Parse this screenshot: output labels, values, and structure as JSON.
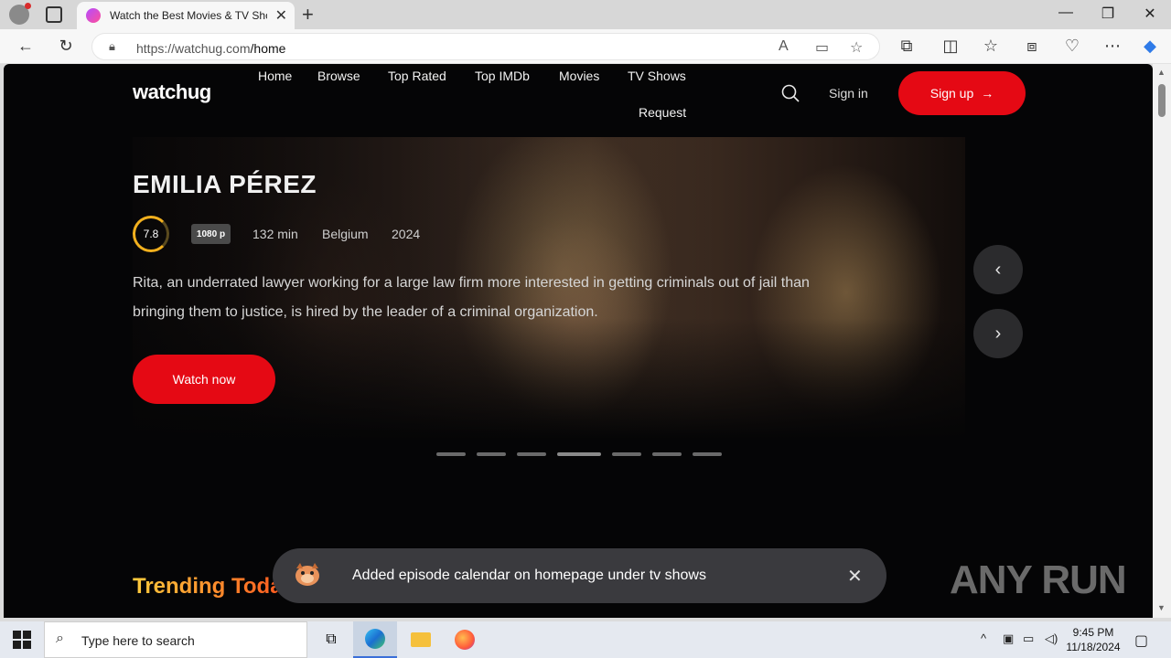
{
  "browser": {
    "tab_title": "Watch the Best Movies & TV Sho",
    "url_host": "https://watchug.com",
    "url_path": "/home"
  },
  "site": {
    "logo": "watchug",
    "nav": [
      "Home",
      "Browse",
      "Top Rated",
      "Top IMDb",
      "Movies",
      "TV Shows",
      "Request"
    ],
    "sign_in": "Sign in",
    "sign_up": "Sign up"
  },
  "hero": {
    "title": "EMILIA PÉREZ",
    "rating": "7.8",
    "quality": "1080 p",
    "duration": "132 min",
    "country": "Belgium",
    "year": "2024",
    "description": "Rita, an underrated lawyer working for a large law firm more interested in getting criminals out of jail than bringing them to justice, is hired by the leader of a criminal organization.",
    "watch_label": "Watch now",
    "slide_count": 7
  },
  "section": {
    "trending": "Trending Toda"
  },
  "toast": {
    "message": "Added episode calendar on homepage under tv shows"
  },
  "watermark": {
    "text": "ANY RUN"
  },
  "taskbar": {
    "search_placeholder": "Type here to search",
    "time": "9:45 PM",
    "date": "11/18/2024"
  },
  "colors": {
    "accent": "#e50914",
    "rating_ring": "#f2b01e",
    "toast_bg": "#3a3a3e"
  }
}
